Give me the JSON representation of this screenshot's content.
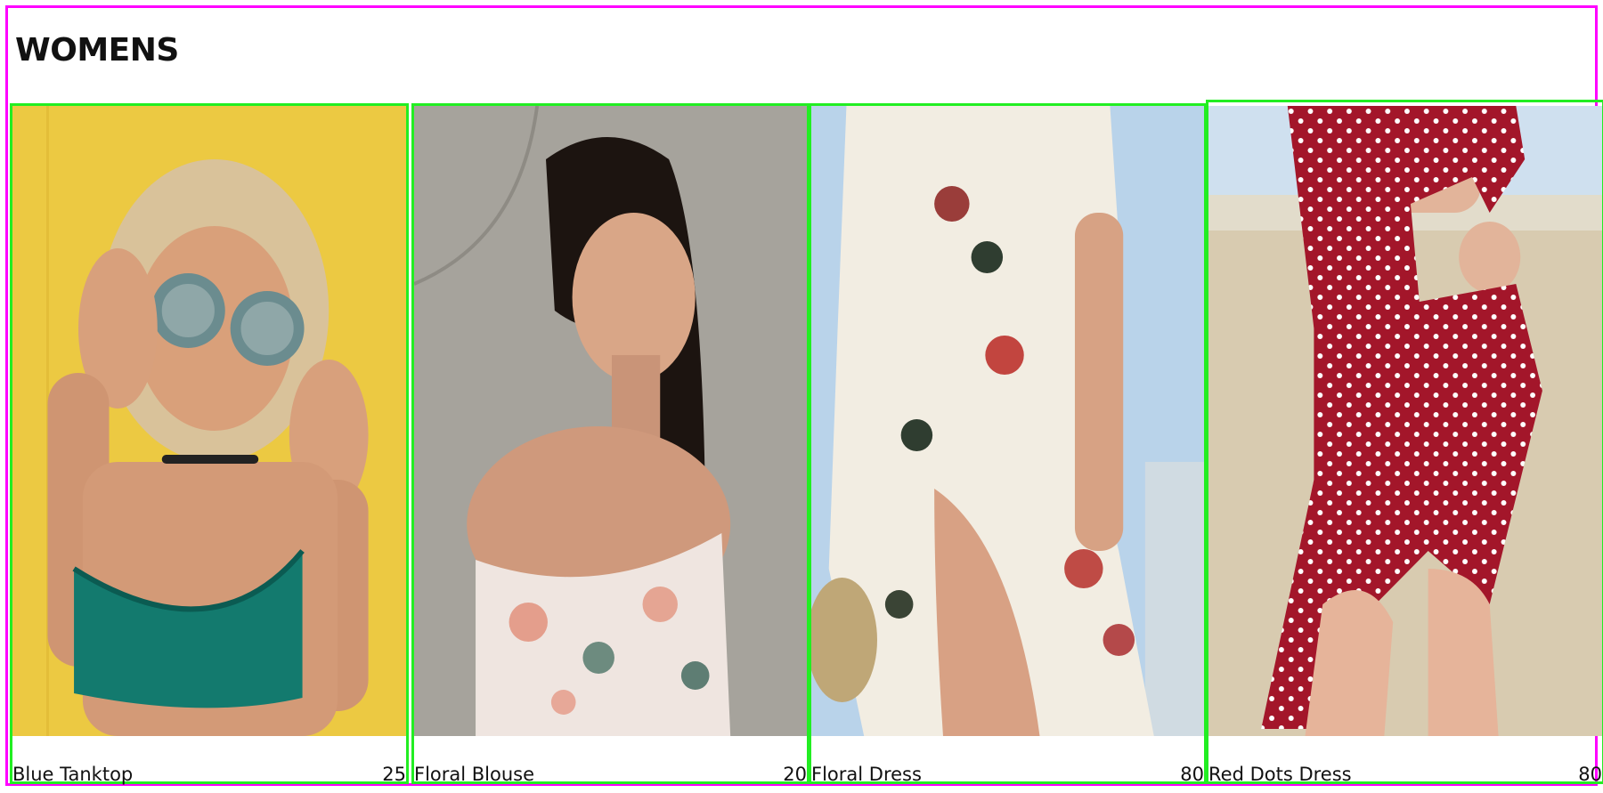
{
  "section": {
    "title": "WOMENS"
  },
  "products": [
    {
      "name": "Blue Tanktop",
      "price": "25",
      "icon": "woman-teal-crop-top-photo"
    },
    {
      "name": "Floral Blouse",
      "price": "20",
      "icon": "woman-floral-off-shoulder-blouse-photo"
    },
    {
      "name": "Floral Dress",
      "price": "80",
      "icon": "woman-cream-floral-wrap-dress-photo"
    },
    {
      "name": "Red Dots Dress",
      "price": "80",
      "icon": "woman-red-polka-dot-dress-photo"
    }
  ],
  "colors": {
    "section_border": "#ff00ff",
    "card_border": "#22ee22"
  }
}
